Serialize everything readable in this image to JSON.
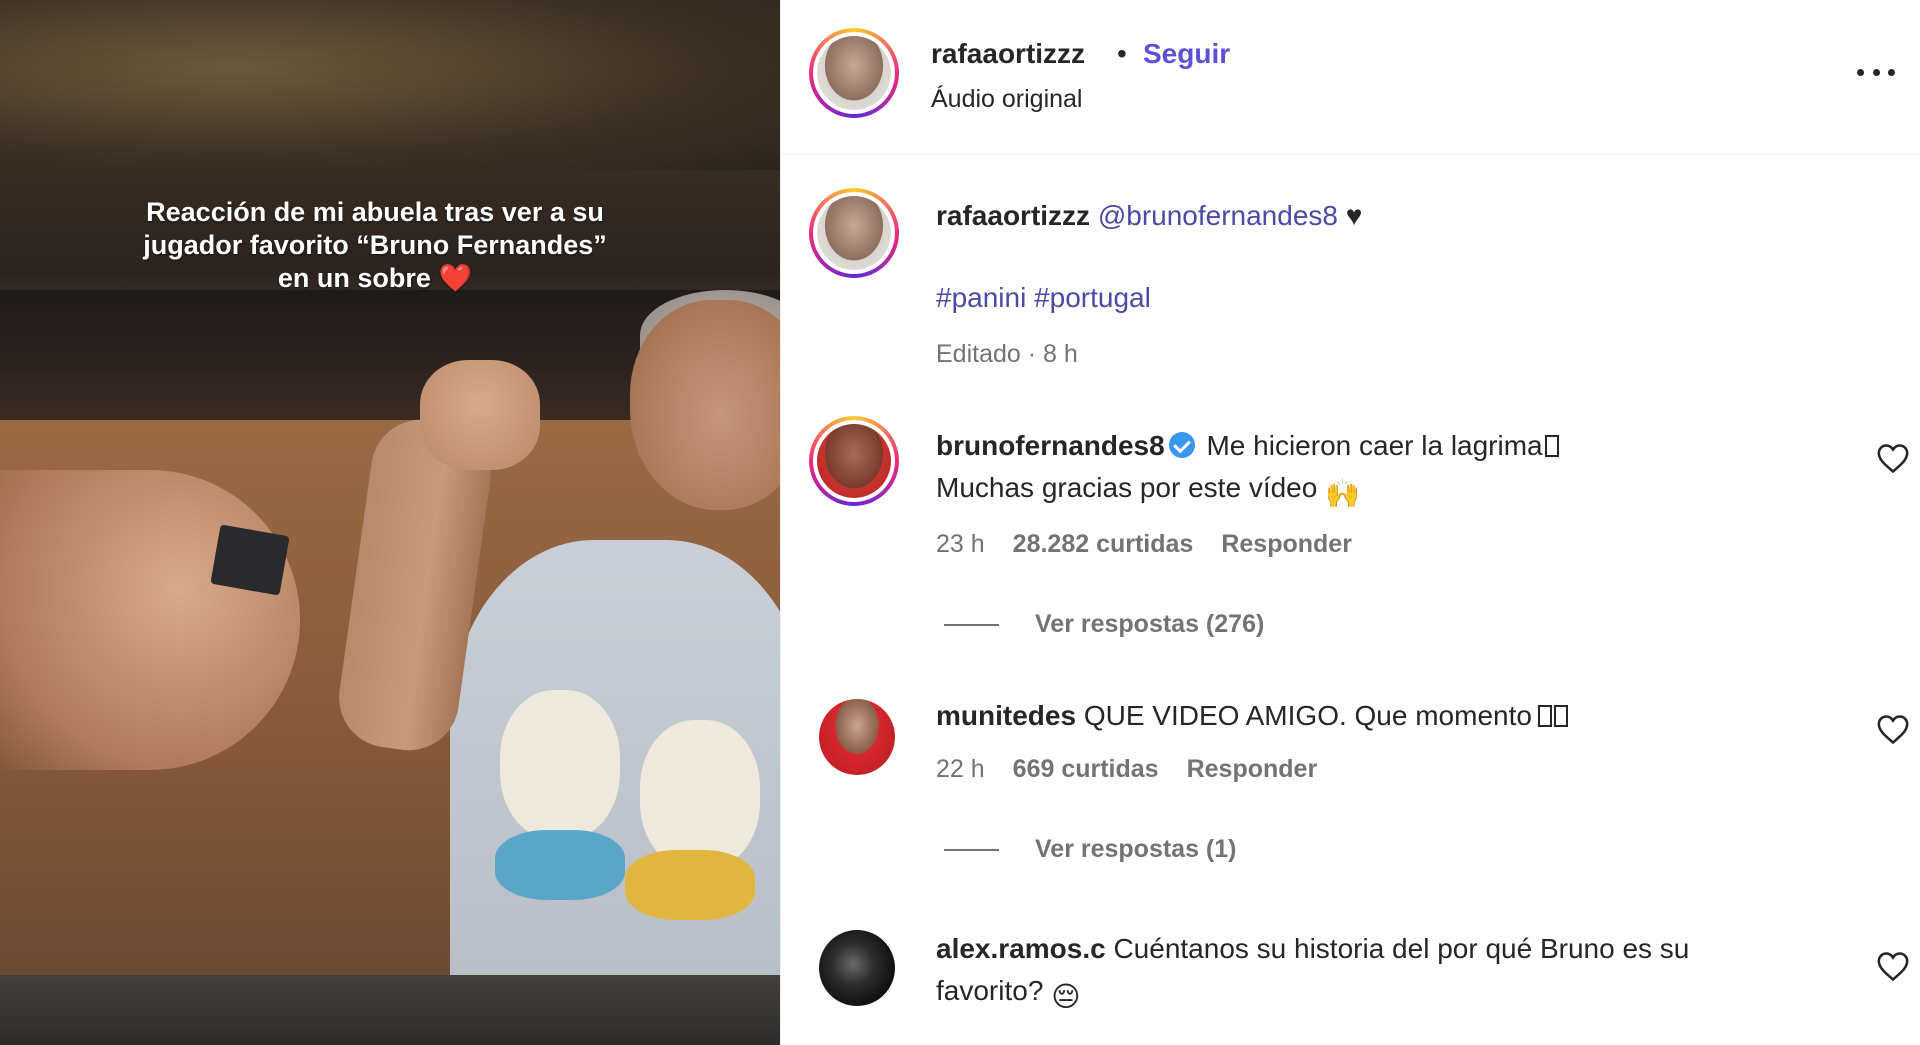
{
  "video": {
    "caption_line1": "Reacción de mi abuela tras ver a su",
    "caption_line2": "jugador favorito “Bruno Fernandes”",
    "caption_line3": "en un sobre",
    "caption_emoji": "❤️"
  },
  "header": {
    "username": "rafaaortizzz",
    "separator": "•",
    "follow_label": "Seguir",
    "audio_label": "Áudio original"
  },
  "caption": {
    "username": "rafaaortizzz",
    "mention": "@brunofernandes8",
    "heart": "♥",
    "tag1": "#panini",
    "tag2": "#portugal",
    "meta": "Editado · 8 h"
  },
  "comments": [
    {
      "username": "brunofernandes8",
      "verified": true,
      "text_line1": "Me hicieron caer la lagrima",
      "text_line2": "Muchas gracias por este vídeo",
      "emoji": "🙌",
      "time": "23 h",
      "likes": "28.282 curtidas",
      "reply_label": "Responder",
      "view_replies": "Ver respostas (276)"
    },
    {
      "username": "munitedes",
      "text": "QUE VIDEO AMIGO. Que momento",
      "time": "22 h",
      "likes": "669 curtidas",
      "reply_label": "Responder",
      "view_replies": "Ver respostas (1)"
    },
    {
      "username": "alex.ramos.c",
      "text_line1": "Cuéntanos su historia del por qué Bruno es su",
      "text_line2": "favorito?",
      "emoji": "😔"
    }
  ],
  "colors": {
    "follow": "#5b51d8",
    "link": "#4a4aa8",
    "muted": "#737373",
    "text": "#262626",
    "verified": "#3897f0",
    "heart": "#e8293c"
  },
  "icons": [
    "more-options-icon",
    "heart-outline-icon",
    "verified-badge-icon"
  ]
}
